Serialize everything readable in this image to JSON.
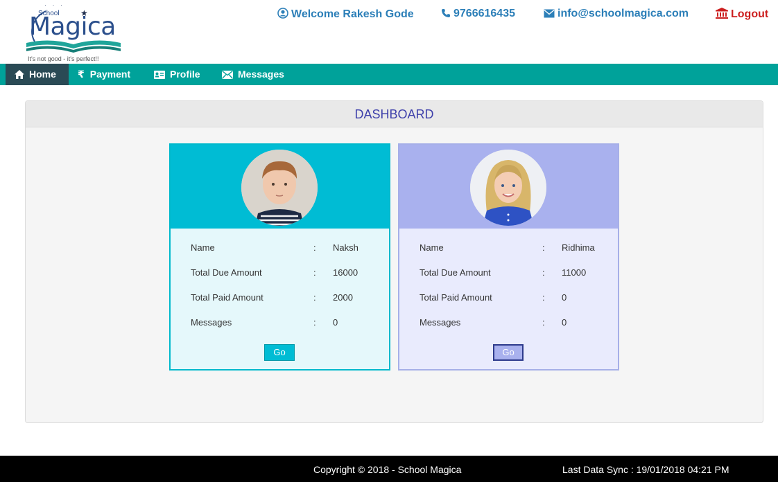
{
  "logo": {
    "school": "School",
    "brand": "Magica",
    "tagline": "It's not good - it's perfect!!"
  },
  "header": {
    "welcome": "Welcome Rakesh Gode",
    "phone": "9766616435",
    "email": "info@schoolmagica.com",
    "logout": "Logout"
  },
  "nav": {
    "items": [
      {
        "label": "Home",
        "icon": "home-icon",
        "active": true
      },
      {
        "label": "Payment",
        "icon": "rupee-icon"
      },
      {
        "label": "Profile",
        "icon": "id-card-icon"
      },
      {
        "label": "Messages",
        "icon": "envelope-icon"
      }
    ]
  },
  "dashboard": {
    "title": "DASHBOARD",
    "students": [
      {
        "labels": {
          "name": "Name",
          "due": "Total Due Amount",
          "paid": "Total Paid Amount",
          "messages": "Messages"
        },
        "name": "Naksh",
        "due": "16000",
        "paid": "2000",
        "messages": "0",
        "button": "Go",
        "colors": {
          "header": "#00bcd4",
          "body": "#e5f8fb",
          "border": "#00b9cc"
        }
      },
      {
        "labels": {
          "name": "Name",
          "due": "Total Due Amount",
          "paid": "Total Paid Amount",
          "messages": "Messages"
        },
        "name": "Ridhima",
        "due": "11000",
        "paid": "0",
        "messages": "0",
        "button": "Go",
        "colors": {
          "header": "#a9b1ee",
          "body": "#e9ebfd",
          "border": "#a6afe8"
        }
      }
    ],
    "separator": ":"
  },
  "footer": {
    "copyright": "Copyright © 2018 - School Magica",
    "sync": "Last Data Sync : 19/01/2018 04:21 PM"
  },
  "colors": {
    "nav": "#00a29a",
    "active_nav": "#2a4a55",
    "link": "#2c7fb8",
    "logout": "#cc1f1f",
    "title": "#3d3faa"
  }
}
